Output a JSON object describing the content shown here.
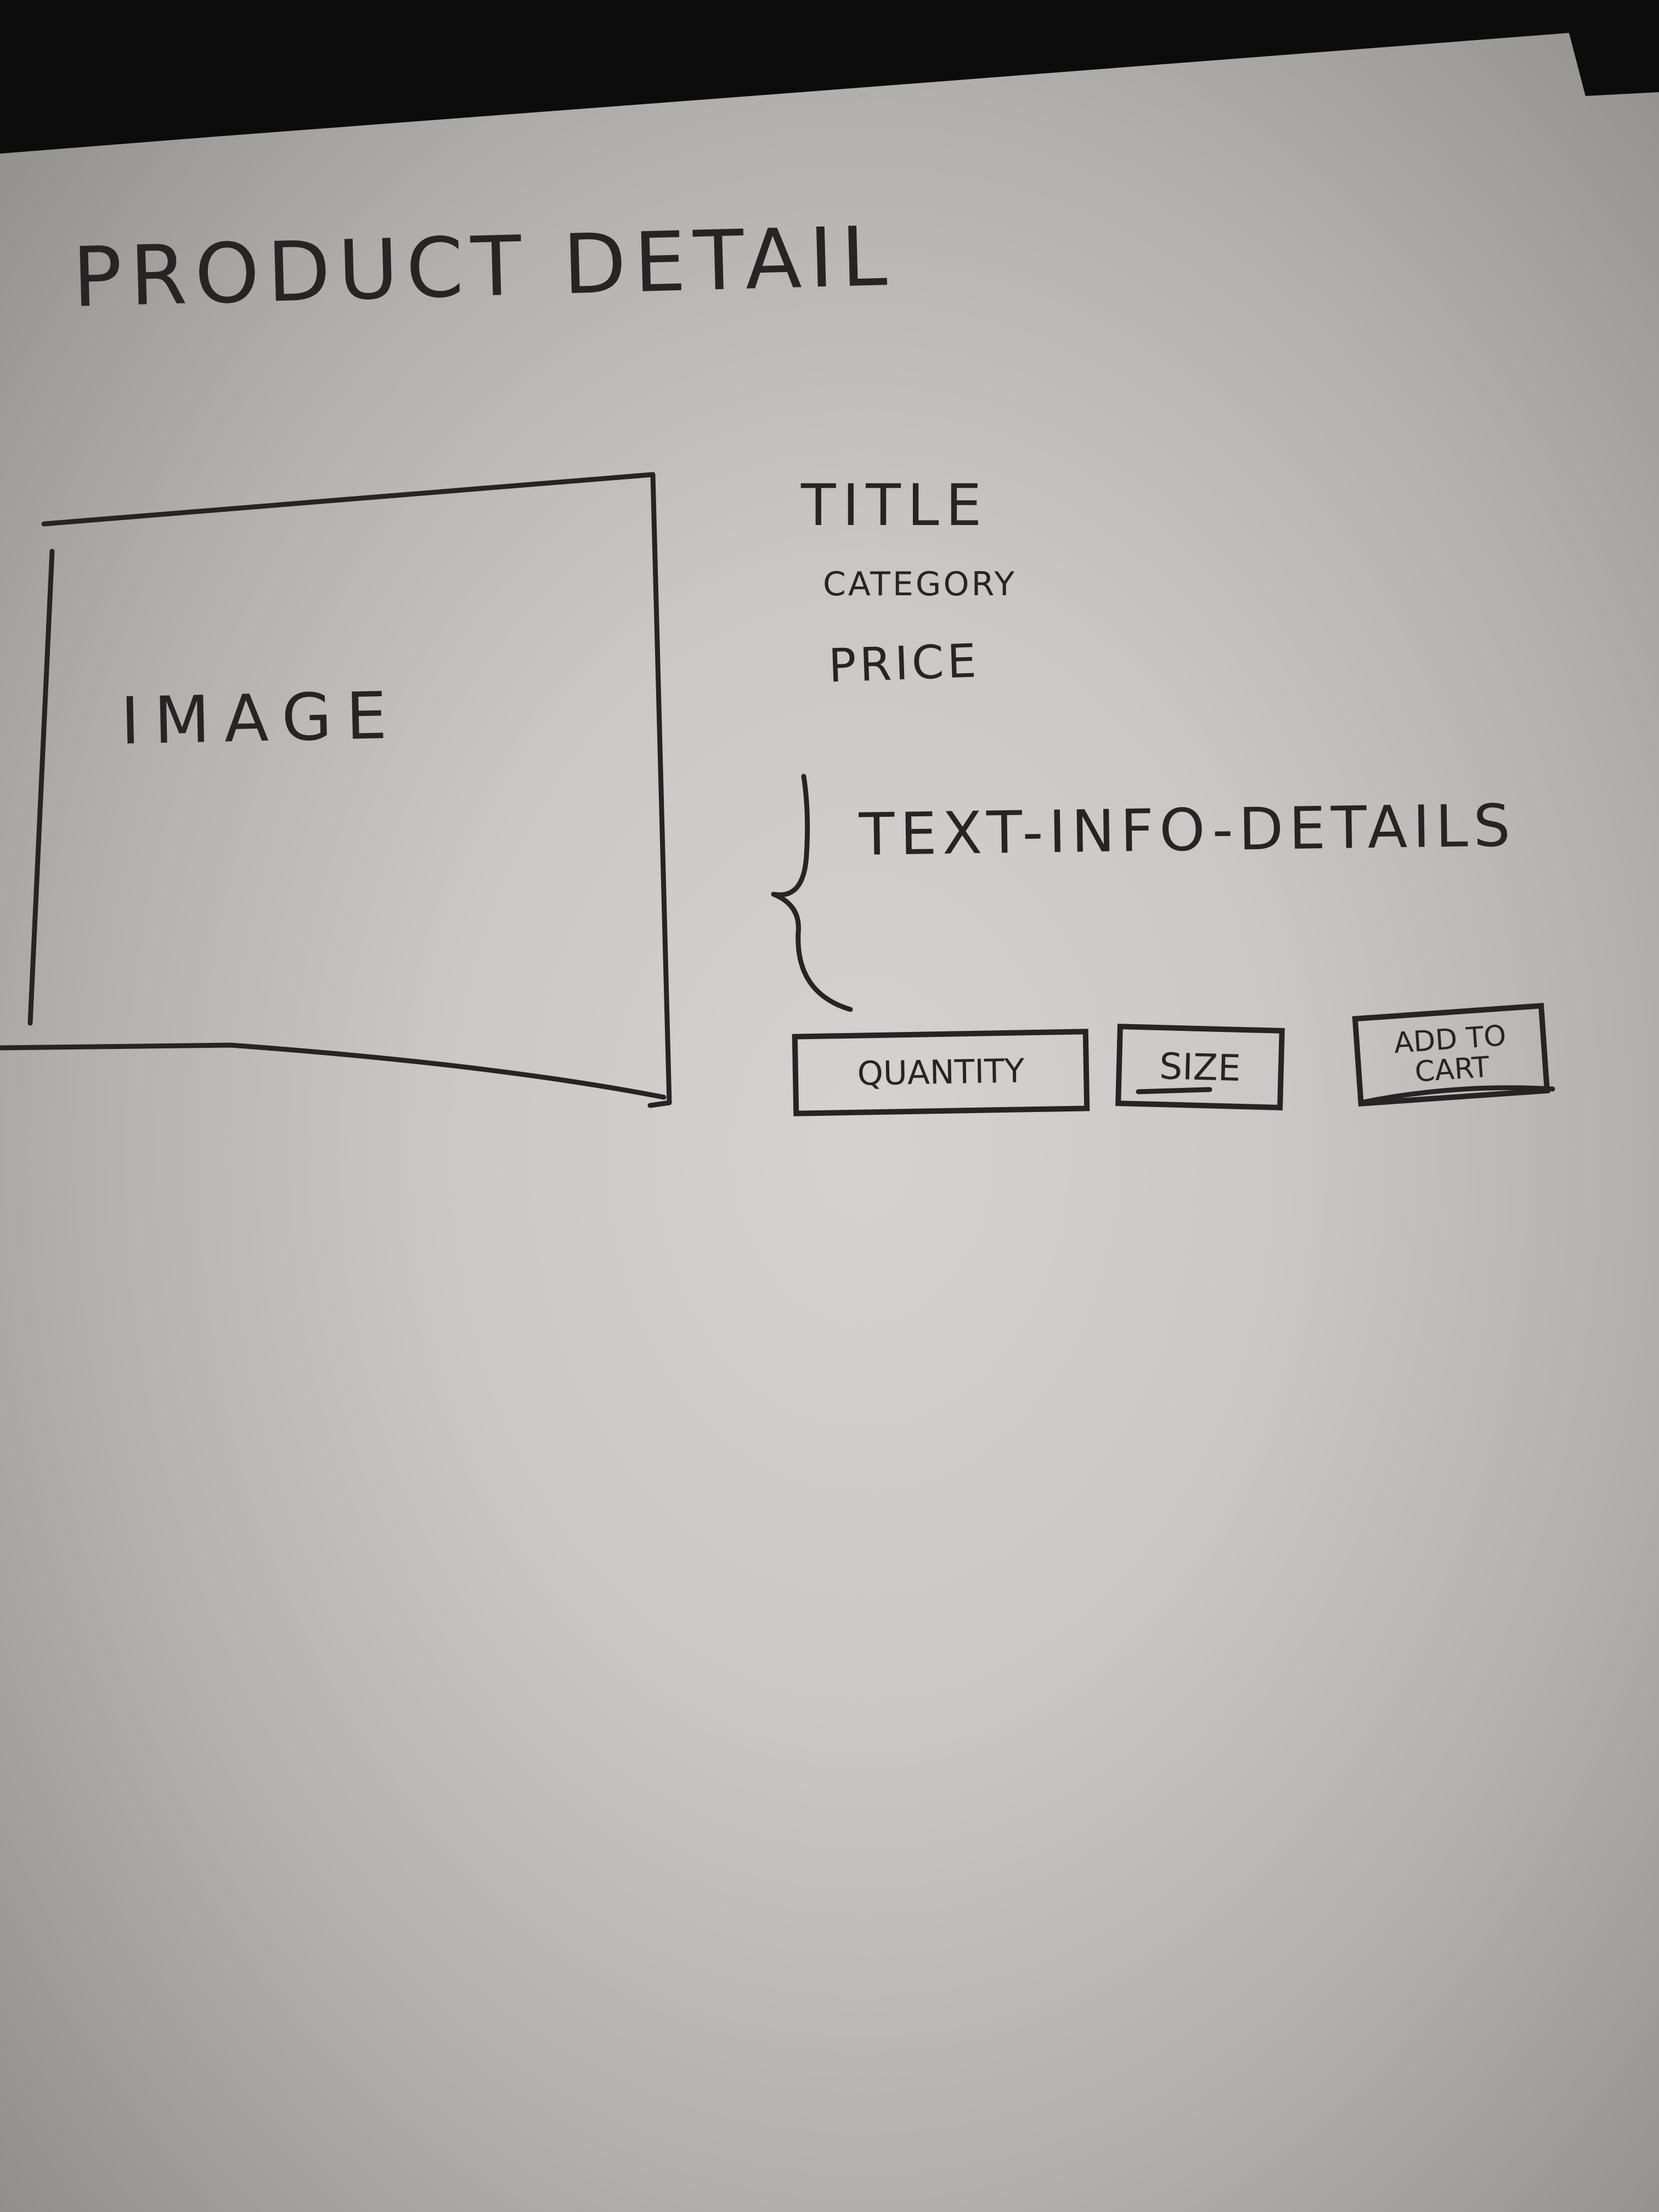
{
  "sketch": {
    "page_title": "PRODUCT DETAIL",
    "image_placeholder_label": "IMAGE",
    "title_label": "TITLE",
    "category_label": "CATEGORY",
    "price_label": "PRICE",
    "details_label": "TEXT-INFO-DETAILS",
    "quantity_label": "QUANTITY",
    "size_label": "SIZE",
    "add_to_cart_line1": "ADD TO",
    "add_to_cart_line2": "CART"
  },
  "colors": {
    "ink": "#262424",
    "paper": "#d2cecd",
    "background": "#0d0c0c"
  }
}
